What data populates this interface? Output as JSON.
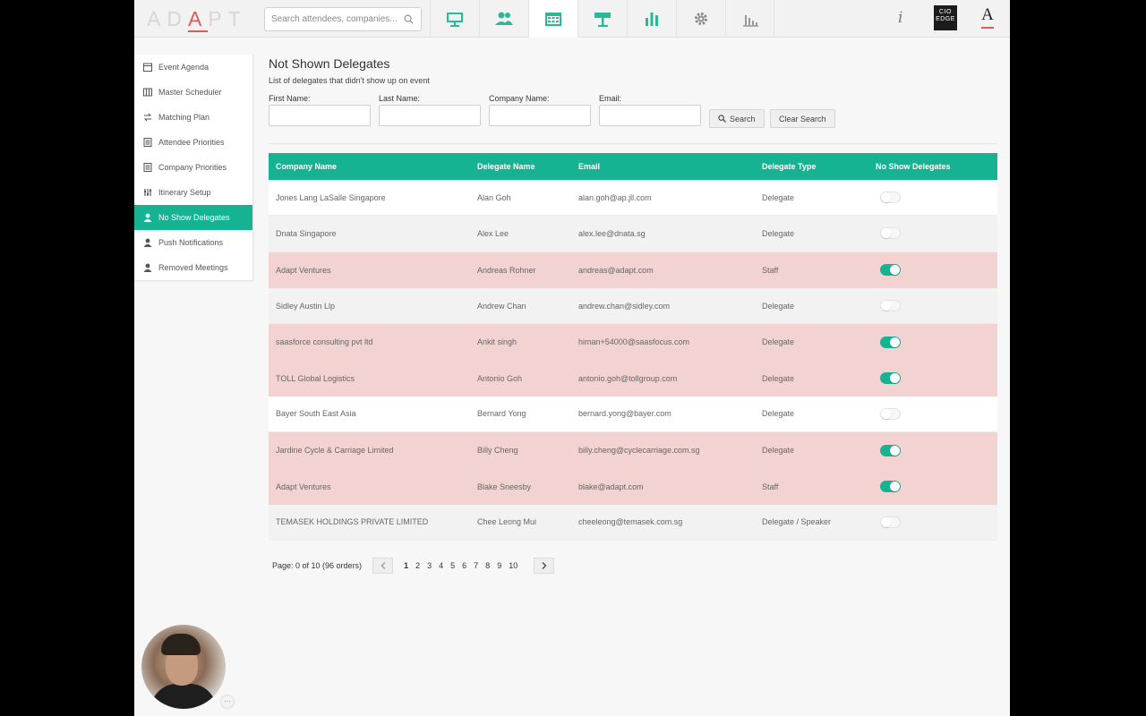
{
  "app": {
    "logo": "ADAPT",
    "search_placeholder": "Search attendees, companies...",
    "nav_tabs": [
      {
        "icon": "presentation-icon",
        "active": false
      },
      {
        "icon": "users-icon",
        "active": false
      },
      {
        "icon": "calendar-icon",
        "active": true
      },
      {
        "icon": "signpost-icon",
        "active": false
      },
      {
        "icon": "bar-chart-icon",
        "active": false
      },
      {
        "icon": "gear-icon",
        "active": false
      },
      {
        "icon": "stats-icon",
        "active": false
      }
    ],
    "info_label": "i",
    "cio_badge": "CIO EDGE",
    "a_badge": "A"
  },
  "sidebar": {
    "items": [
      {
        "label": "Event Agenda",
        "icon": "calendar-icon",
        "active": false
      },
      {
        "label": "Master Scheduler",
        "icon": "grid-icon",
        "active": false
      },
      {
        "label": "Matching Plan",
        "icon": "swap-icon",
        "active": false
      },
      {
        "label": "Attendee Priorities",
        "icon": "list-icon",
        "active": false
      },
      {
        "label": "Company Priorities",
        "icon": "list-icon",
        "active": false
      },
      {
        "label": "Itinerary Setup",
        "icon": "sliders-icon",
        "active": false
      },
      {
        "label": "No Show Delegates",
        "icon": "user-icon",
        "active": true
      },
      {
        "label": "Push Notifications",
        "icon": "user-icon",
        "active": false
      },
      {
        "label": "Removed Meetings",
        "icon": "user-icon",
        "active": false
      }
    ]
  },
  "page": {
    "title": "Not Shown Delegates",
    "subtitle": "List of delegates that didn't show up on event"
  },
  "filters": {
    "first_name_label": "First Name:",
    "last_name_label": "Last Name:",
    "company_name_label": "Company Name:",
    "email_label": "Email:",
    "first_name_value": "",
    "last_name_value": "",
    "company_name_value": "",
    "email_value": "",
    "search_label": "Search",
    "clear_label": "Clear Search"
  },
  "table": {
    "headers": [
      "Company Name",
      "Delegate Name",
      "Email",
      "Delegate Type",
      "No Show Delegates"
    ],
    "rows": [
      {
        "company": "Jones Lang LaSalle Singapore",
        "name": "Alan Goh",
        "email": "alan.goh@ap.jll.com",
        "type": "Delegate",
        "no_show": false,
        "highlight": "white"
      },
      {
        "company": "Dnata Singapore",
        "name": "Alex Lee",
        "email": "alex.lee@dnata.sg",
        "type": "Delegate",
        "no_show": false,
        "highlight": "grey"
      },
      {
        "company": "Adapt Ventures",
        "name": "Andreas Rohner",
        "email": "andreas@adapt.com",
        "type": "Staff",
        "no_show": true,
        "highlight": "pink"
      },
      {
        "company": "Sidley Austin Llp",
        "name": "Andrew Chan",
        "email": "andrew.chan@sidley.com",
        "type": "Delegate",
        "no_show": false,
        "highlight": "grey"
      },
      {
        "company": "saasforce consulting pvt ltd",
        "name": "Ankit singh",
        "email": "himan+54000@saasfocus.com",
        "type": "Delegate",
        "no_show": true,
        "highlight": "pink"
      },
      {
        "company": "TOLL Global Logistics",
        "name": "Antonio Goh",
        "email": "antonio.goh@tollgroup.com",
        "type": "Delegate",
        "no_show": true,
        "highlight": "pink"
      },
      {
        "company": "Bayer South East Asia",
        "name": "Bernard Yong",
        "email": "bernard.yong@bayer.com",
        "type": "Delegate",
        "no_show": false,
        "highlight": "white"
      },
      {
        "company": "Jardine Cycle & Carriage Limited",
        "name": "Billy Cheng",
        "email": "billy.cheng@cyclecarriage.com.sg",
        "type": "Delegate",
        "no_show": true,
        "highlight": "pink"
      },
      {
        "company": "Adapt Ventures",
        "name": "Blake Sneesby",
        "email": "blake@adapt.com",
        "type": "Staff",
        "no_show": true,
        "highlight": "pink"
      },
      {
        "company": "TEMASEK HOLDINGS PRIVATE LIMITED",
        "name": "Chee Leong Mui",
        "email": "cheeleong@temasek.com.sg",
        "type": "Delegate / Speaker",
        "no_show": false,
        "highlight": "grey"
      }
    ]
  },
  "pagination": {
    "summary": "Page: 0 of 10 (96 orders)",
    "pages": [
      "1",
      "2",
      "3",
      "4",
      "5",
      "6",
      "7",
      "8",
      "9",
      "10"
    ],
    "current": "1"
  },
  "video": {
    "more_label": "···"
  },
  "colors": {
    "accent": "#16b393",
    "highlight_row": "#f2d3d1",
    "logo_accent": "#e05a5a"
  }
}
